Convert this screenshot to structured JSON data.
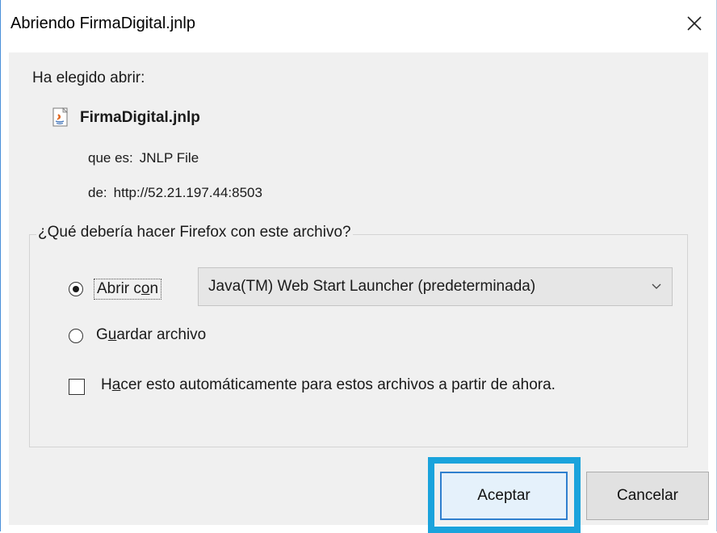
{
  "window": {
    "title": "Abriendo FirmaDigital.jnlp",
    "close_glyph": "×"
  },
  "dialog": {
    "intro": "Ha elegido abrir:",
    "file_icon": "java-jnlp-file-icon",
    "file_name": "FirmaDigital.jnlp",
    "type_label": "que es:",
    "type_value": "JNLP File",
    "from_label": "de:",
    "from_value": "http://52.21.197.44:8503"
  },
  "action_group": {
    "legend": "¿Qué debería hacer Firefox con este archivo?",
    "open_with": {
      "label_pre": "Abrir c",
      "label_ul": "o",
      "label_post": "n",
      "selected": true
    },
    "application_select": {
      "value": "Java(TM) Web Start Launcher (predeterminada)"
    },
    "save_file": {
      "label_pre": "G",
      "label_ul": "u",
      "label_post": "ardar archivo",
      "selected": false
    },
    "auto_checkbox": {
      "label_pre": "H",
      "label_ul": "a",
      "label_post": "cer esto automáticamente para estos archivos a partir de ahora.",
      "checked": false
    }
  },
  "buttons": {
    "accept": "Aceptar",
    "cancel": "Cancelar"
  },
  "colors": {
    "focus_ring": "#1aa3dc",
    "accept_border": "#2f7fce",
    "dialog_bg": "#f0f0f0"
  }
}
